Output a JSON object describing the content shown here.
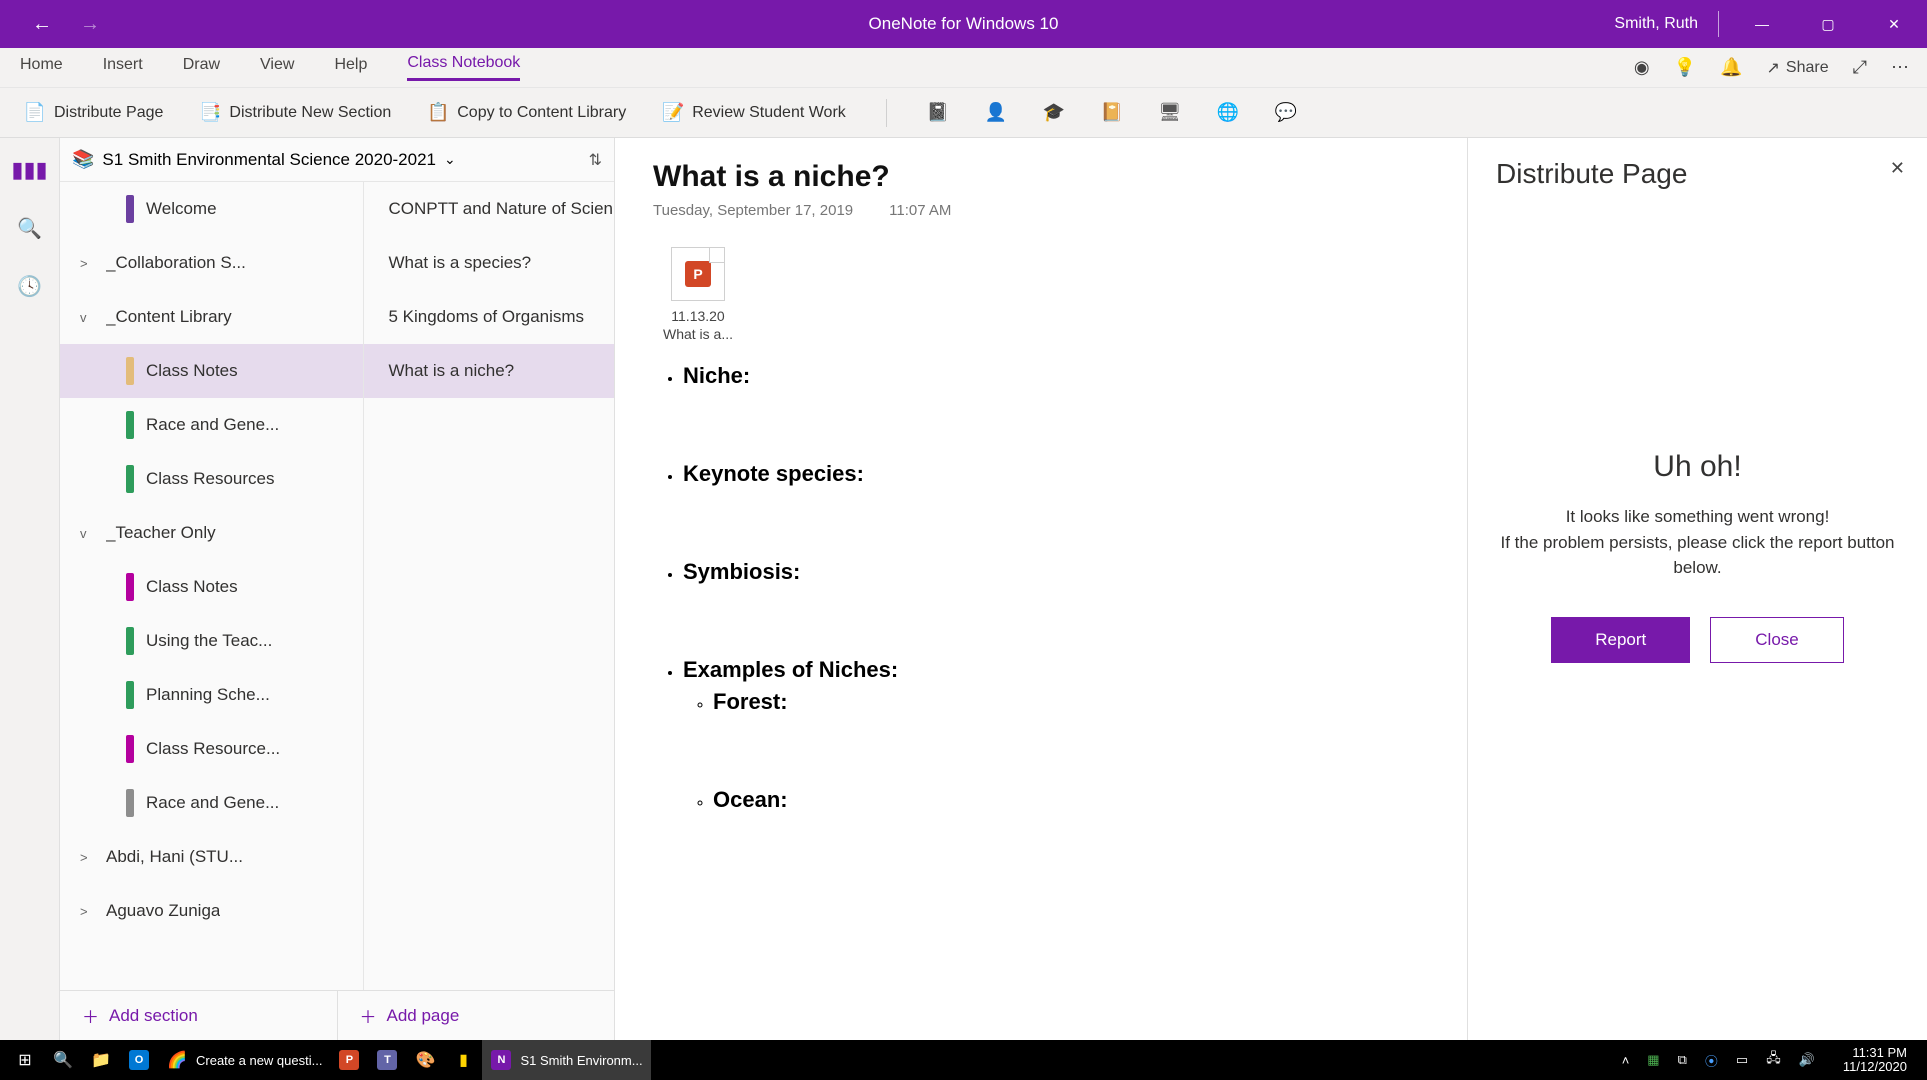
{
  "titlebar": {
    "app_title": "OneNote for Windows 10",
    "user": "Smith, Ruth"
  },
  "ribbon": {
    "tabs": [
      {
        "label": "Home"
      },
      {
        "label": "Insert"
      },
      {
        "label": "Draw"
      },
      {
        "label": "View"
      },
      {
        "label": "Help"
      },
      {
        "label": "Class Notebook"
      }
    ],
    "share_label": "Share"
  },
  "toolbar": {
    "distribute_page": "Distribute Page",
    "distribute_section": "Distribute New Section",
    "copy_library": "Copy to Content Library",
    "review_work": "Review Student Work"
  },
  "notebook": {
    "name": "S1 Smith Environmental Science 2020-2021"
  },
  "sections": [
    {
      "type": "section",
      "indent": true,
      "color": "#6b3fa0",
      "name": "Welcome"
    },
    {
      "type": "group",
      "chev": ">",
      "name": "_Collaboration S..."
    },
    {
      "type": "group",
      "chev": "v",
      "name": "_Content Library"
    },
    {
      "type": "section",
      "indent": true,
      "color": "#e3bc7a",
      "name": "Class Notes",
      "selected": true
    },
    {
      "type": "section",
      "indent": true,
      "color": "#2e9c5b",
      "name": "Race and Gene..."
    },
    {
      "type": "section",
      "indent": true,
      "color": "#2e9c5b",
      "name": "Class Resources"
    },
    {
      "type": "group",
      "chev": "v",
      "name": "_Teacher Only"
    },
    {
      "type": "section",
      "indent": true,
      "color": "#b4009e",
      "name": "Class Notes"
    },
    {
      "type": "section",
      "indent": true,
      "color": "#2e9c5b",
      "name": "Using the Teac..."
    },
    {
      "type": "section",
      "indent": true,
      "color": "#2e9c5b",
      "name": "Planning Sche..."
    },
    {
      "type": "section",
      "indent": true,
      "color": "#b4009e",
      "name": "Class Resource..."
    },
    {
      "type": "section",
      "indent": true,
      "color": "#8d8d8d",
      "name": "Race and Gene..."
    },
    {
      "type": "group",
      "chev": ">",
      "name": "Abdi, Hani  (STU..."
    },
    {
      "type": "group",
      "chev": ">",
      "name": "Aguavo  Zuniga"
    }
  ],
  "pages": [
    {
      "name": "CONPTT and Nature of Scien..."
    },
    {
      "name": "What is a species?"
    },
    {
      "name": "5 Kingdoms of Organisms"
    },
    {
      "name": "What is a niche?",
      "selected": true
    }
  ],
  "add": {
    "section": "Add section",
    "page": "Add page"
  },
  "page_content": {
    "title": "What is a niche?",
    "date": "Tuesday, September 17, 2019",
    "time": "11:07 AM",
    "attachment_line1": "11.13.20",
    "attachment_line2": "What is a...",
    "bullets": {
      "niche": "Niche:",
      "keynote": "Keynote species:",
      "symbiosis": "Symbiosis:",
      "examples": "Examples of Niches:",
      "forest": "Forest:",
      "ocean": "Ocean:"
    }
  },
  "right_pane": {
    "title": "Distribute Page",
    "error_heading": "Uh oh!",
    "error_line1": "It looks like something went wrong!",
    "error_line2": "If the problem persists, please click the report button below.",
    "report": "Report",
    "close": "Close"
  },
  "taskbar": {
    "chrome_label": "Create a new questi...",
    "onenote_label": "S1 Smith Environm...",
    "time": "11:31 PM",
    "date": "11/12/2020"
  }
}
